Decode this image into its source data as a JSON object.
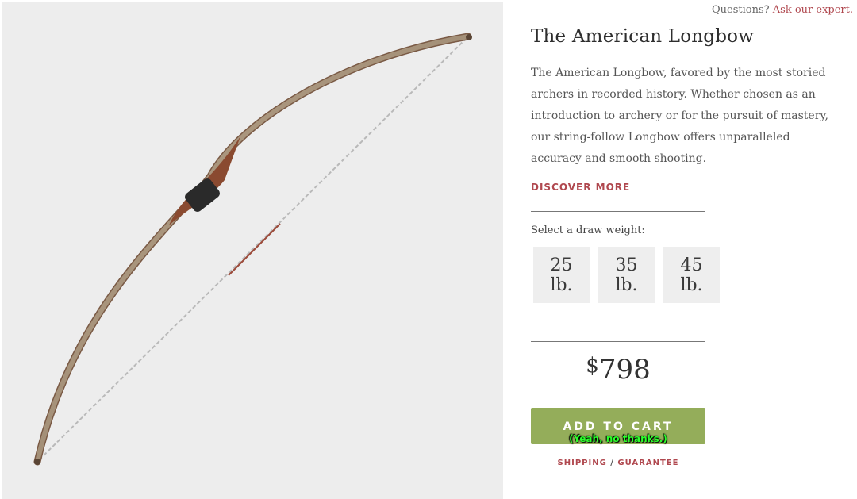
{
  "header": {
    "questions_text": "Questions?",
    "ask_expert_label": "Ask our expert."
  },
  "product": {
    "title": "The American Longbow",
    "description": "The American Longbow, favored by the most storied archers in recorded history. Whether chosen as an introduction to archery or for the pursuit of mastery, our string-follow Longbow offers unparalleled accuracy and smooth shooting.",
    "discover_label": "DISCOVER MORE",
    "image_icon": "longbow-product-image"
  },
  "draw_weight": {
    "label": "Select a draw weight:",
    "options": [
      "25 lb.",
      "35 lb.",
      "45 lb."
    ]
  },
  "price": {
    "currency": "$",
    "amount": "798"
  },
  "cart": {
    "add_label": "ADD TO CART",
    "decline_label": "(Yeah, no thanks.)"
  },
  "links": {
    "shipping": "SHIPPING",
    "separator": "/",
    "guarantee": "GUARANTEE"
  },
  "colors": {
    "accent": "#b0484f",
    "cart_button": "#94ad5a",
    "image_bg": "#ededed"
  }
}
